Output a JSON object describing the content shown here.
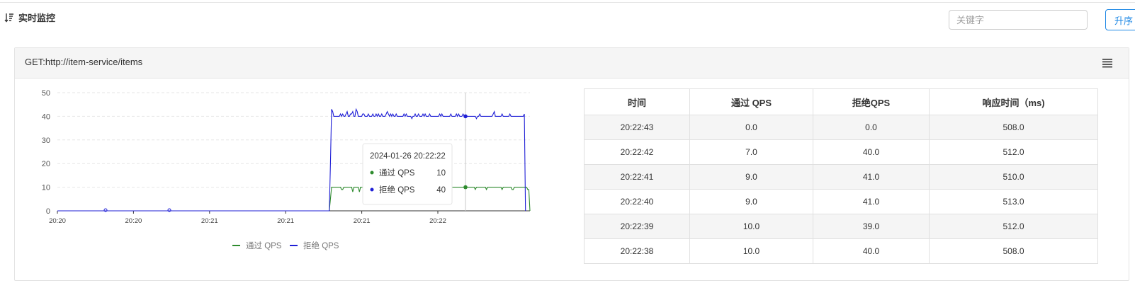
{
  "header": {
    "title": "实时监控",
    "search_placeholder": "关键字",
    "sort_button": "升序"
  },
  "panel": {
    "title": "GET:http://item-service/items"
  },
  "tooltip": {
    "title": "2024-01-26 20:22:22",
    "rows": [
      {
        "label": "通过 QPS",
        "value": "10"
      },
      {
        "label": "拒绝 QPS",
        "value": "40"
      }
    ]
  },
  "table": {
    "headers": [
      "时间",
      "通过 QPS",
      "拒绝QPS",
      "响应时间（ms)"
    ],
    "rows": [
      [
        "20:22:43",
        "0.0",
        "0.0",
        "508.0"
      ],
      [
        "20:22:42",
        "7.0",
        "40.0",
        "512.0"
      ],
      [
        "20:22:41",
        "9.0",
        "41.0",
        "510.0"
      ],
      [
        "20:22:40",
        "9.0",
        "41.0",
        "513.0"
      ],
      [
        "20:22:39",
        "10.0",
        "39.0",
        "512.0"
      ],
      [
        "20:22:38",
        "10.0",
        "40.0",
        "508.0"
      ]
    ]
  },
  "chart_data": {
    "type": "line",
    "x_tick_labels": [
      "20:20",
      "20:20",
      "20:21",
      "20:21",
      "20:21",
      "20:22"
    ],
    "yticks": [
      0,
      10,
      20,
      30,
      40,
      50
    ],
    "ylim": [
      0,
      50
    ],
    "grid": true,
    "legend_position": "bottom",
    "series": [
      {
        "name": "通过 QPS",
        "color": "#2e8b2e",
        "values": [
          0,
          0,
          0,
          0,
          0,
          0,
          0,
          0,
          0,
          0,
          0,
          0,
          0,
          0,
          0,
          0,
          0,
          0,
          0,
          0,
          0,
          0,
          0,
          0,
          0,
          0,
          0,
          0,
          0,
          0,
          0,
          0,
          0,
          0,
          0,
          0,
          0,
          0,
          0,
          0,
          0,
          0,
          0,
          0,
          0,
          0,
          0,
          0,
          0,
          0,
          0,
          0,
          0,
          0,
          0,
          0,
          0,
          0,
          0,
          0,
          0,
          0,
          0,
          0,
          0,
          0,
          0,
          0,
          0,
          0,
          0,
          0,
          0,
          0,
          0,
          0,
          0,
          0,
          0,
          0,
          0,
          0,
          0,
          0,
          0,
          0,
          0,
          0,
          0,
          0,
          0,
          0,
          0,
          0,
          0,
          0,
          0,
          0,
          0,
          0,
          0,
          0,
          0,
          0,
          0,
          0,
          0,
          0,
          0,
          0,
          0,
          0,
          0,
          0,
          0,
          0,
          0,
          0,
          0,
          0,
          0,
          0,
          0,
          0,
          0,
          0,
          0,
          0,
          0,
          0,
          0,
          0,
          0,
          0,
          0,
          0,
          0,
          0,
          0,
          0,
          0,
          0,
          0,
          0,
          0,
          0,
          0,
          0,
          0,
          0,
          0,
          0,
          0,
          0,
          0,
          0,
          0,
          0,
          0,
          0,
          0,
          0,
          0,
          0,
          0,
          0,
          0,
          0,
          0,
          0,
          0,
          0,
          0,
          0,
          0,
          0,
          0,
          0,
          0,
          0,
          0,
          0,
          0,
          0,
          0,
          0,
          0,
          0,
          0,
          0,
          0,
          0,
          0,
          0,
          0,
          0,
          0,
          0,
          0,
          0,
          0,
          0,
          0,
          0,
          0,
          0,
          0,
          0,
          0,
          0,
          0,
          0,
          0,
          0,
          0,
          0,
          0,
          0,
          0,
          0,
          0,
          0,
          0,
          0,
          0,
          0,
          0,
          0,
          0,
          0,
          0,
          0,
          0,
          0,
          0,
          0,
          0,
          0,
          0,
          0,
          0,
          0,
          0,
          0,
          0,
          5,
          10,
          10,
          10,
          10,
          10,
          10,
          10,
          10,
          10,
          9,
          9,
          10,
          10,
          10,
          10,
          10,
          10,
          10,
          10,
          8,
          10,
          10,
          10,
          10,
          10,
          8,
          10,
          10,
          10,
          10,
          10,
          10,
          10,
          9,
          10,
          10,
          10,
          10,
          10,
          10,
          10,
          10,
          10,
          8,
          8,
          10,
          10,
          10,
          9,
          9,
          10,
          10,
          10,
          10,
          10,
          10,
          10,
          10,
          10,
          10,
          10,
          10,
          10,
          10,
          10,
          10,
          10,
          10,
          10,
          10,
          9,
          10,
          10,
          9,
          10,
          9,
          10,
          10,
          10,
          10,
          10,
          10,
          10,
          10,
          10,
          10,
          10,
          10,
          10,
          10,
          10,
          10,
          10,
          10,
          10,
          10,
          9,
          9,
          10,
          10,
          10,
          10,
          10,
          10,
          10,
          10,
          10,
          10,
          10,
          10,
          10,
          10,
          10,
          10,
          10,
          10,
          10,
          10,
          10,
          10,
          10,
          10,
          10,
          10,
          10,
          10,
          10,
          10,
          10,
          9,
          10,
          10,
          10,
          10,
          10,
          10,
          10,
          10,
          10,
          9,
          10,
          10,
          10,
          10,
          10,
          10,
          10,
          10,
          10,
          10,
          10,
          10,
          10,
          9,
          10,
          10,
          10,
          10,
          10,
          10,
          10,
          10,
          9,
          9,
          10,
          10,
          10,
          10,
          10,
          10,
          10,
          10,
          10,
          10,
          10,
          10,
          9,
          9,
          0
        ]
      },
      {
        "name": "拒绝 QPS",
        "color": "#1f1fd6",
        "values": [
          0,
          0,
          0,
          0,
          0,
          0,
          0,
          0,
          0,
          0,
          0,
          0,
          0,
          0,
          0,
          0,
          0,
          0,
          0,
          0,
          0,
          0,
          0,
          0,
          0,
          0,
          0,
          0,
          0,
          0,
          0,
          0,
          0,
          0,
          0,
          0,
          0,
          0,
          0,
          0,
          0,
          0,
          0,
          0,
          0,
          0,
          0,
          0,
          0,
          0,
          0,
          0,
          0,
          0,
          0,
          0,
          0,
          0,
          0,
          0,
          0,
          0,
          0,
          0,
          0,
          0,
          0,
          0,
          0,
          0,
          0,
          0,
          0,
          0,
          0,
          0,
          0,
          0,
          0,
          0,
          0,
          0,
          0,
          0,
          0,
          0,
          0,
          0,
          0,
          0,
          0,
          0,
          0,
          0,
          0,
          0,
          0,
          0,
          0,
          0,
          0,
          0,
          0,
          0,
          0,
          0,
          0,
          0,
          0,
          0,
          0,
          0,
          0,
          0,
          0,
          0,
          0,
          0,
          0,
          0,
          0,
          0,
          0,
          0,
          0,
          0,
          0,
          0,
          0,
          0,
          0,
          0,
          0,
          0,
          0,
          0,
          0,
          0,
          0,
          0,
          0,
          0,
          0,
          0,
          0,
          0,
          0,
          0,
          0,
          0,
          0,
          0,
          0,
          0,
          0,
          0,
          0,
          0,
          0,
          0,
          0,
          0,
          0,
          0,
          0,
          0,
          0,
          0,
          0,
          0,
          0,
          0,
          0,
          0,
          0,
          0,
          0,
          0,
          0,
          0,
          0,
          0,
          0,
          0,
          0,
          0,
          0,
          0,
          0,
          0,
          0,
          0,
          0,
          0,
          0,
          0,
          0,
          0,
          0,
          0,
          0,
          0,
          0,
          0,
          0,
          0,
          0,
          0,
          0,
          0,
          0,
          0,
          0,
          0,
          0,
          0,
          0,
          0,
          0,
          0,
          0,
          0,
          0,
          0,
          0,
          0,
          0,
          0,
          0,
          0,
          0,
          0,
          0,
          0,
          0,
          0,
          0,
          0,
          0,
          0,
          0,
          0,
          0,
          0,
          0,
          20,
          43,
          42,
          40,
          40,
          40,
          40,
          40,
          40,
          41,
          40,
          41,
          40,
          40,
          41,
          42,
          40,
          40,
          41,
          41,
          42,
          40,
          40,
          43,
          42,
          40,
          40,
          40,
          40,
          41,
          41,
          40,
          40,
          40,
          41,
          40,
          40,
          40,
          41,
          40,
          40,
          41,
          40,
          41,
          40,
          40,
          41,
          40,
          40,
          40,
          41,
          42,
          41,
          40,
          41,
          40,
          41,
          40,
          40,
          41,
          40,
          40,
          40,
          40,
          40,
          40,
          41,
          40,
          41,
          40,
          40,
          40,
          40,
          39,
          40,
          40,
          41,
          40,
          40,
          41,
          40,
          40,
          40,
          41,
          40,
          41,
          40,
          40,
          40,
          41,
          40,
          40,
          40,
          40,
          40,
          40,
          40,
          40,
          41,
          40,
          41,
          40,
          40,
          40,
          40,
          40,
          40,
          40,
          41,
          40,
          40,
          40,
          40,
          41,
          40,
          41,
          40,
          40,
          40,
          41,
          40,
          40,
          40,
          40,
          40,
          40,
          40,
          40,
          40,
          40,
          40,
          39,
          40,
          40,
          41,
          40,
          40,
          40,
          40,
          40,
          40,
          40,
          40,
          40,
          40,
          40,
          41,
          42,
          40,
          40,
          40,
          40,
          40,
          40,
          41,
          40,
          40,
          40,
          40,
          40,
          40,
          41,
          40,
          40,
          40,
          40,
          40,
          40,
          40,
          40,
          40,
          40,
          40,
          40,
          41,
          0
        ]
      }
    ],
    "special_points": [
      {
        "x_index": 1,
        "value": 0
      },
      {
        "x_index": 2,
        "value": 0
      }
    ]
  }
}
